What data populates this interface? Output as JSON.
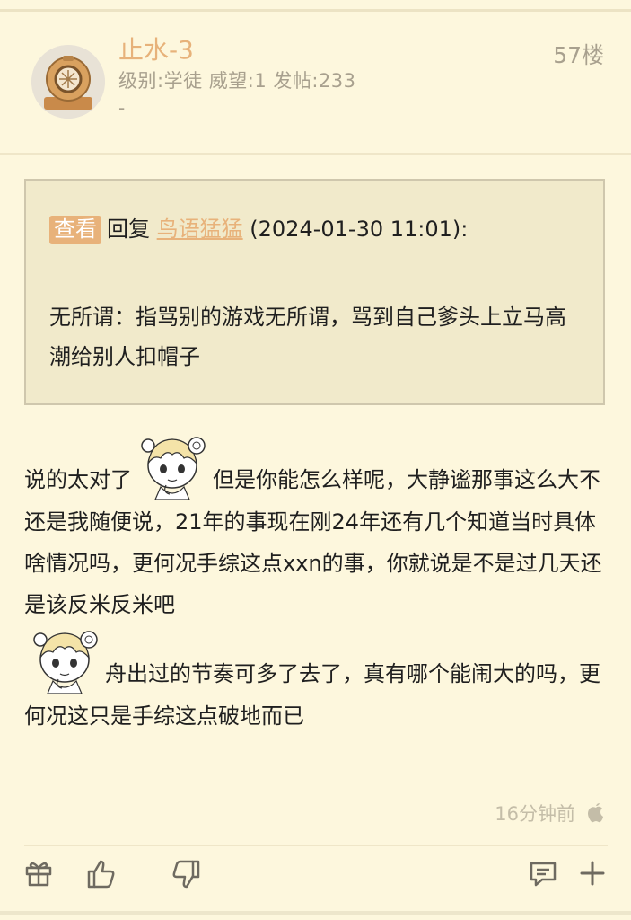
{
  "post": {
    "author": "止水-3",
    "meta": "级别:学徒 威望:1 发帖:233",
    "dash": "-",
    "floor": "57楼"
  },
  "quote": {
    "badge": "查看",
    "reply_prefix": "回复",
    "reply_user": "鸟语猛猛",
    "reply_time": "(2024-01-30 11:01):",
    "text": "无所谓：指骂别的游戏无所谓，骂到自己爹头上立马高潮给别人扣帽子"
  },
  "content": {
    "part1": "说的太对了",
    "part2": "但是你能怎么样呢，大静谧那事这么大不还是我随便说，21年的事现在刚24年还有几个知道当时具体啥情况吗，更何况手综这点xxn的事，你就说是不是过几天还是该反米反米吧",
    "part3": "舟出过的节奏可多了去了，真有哪个能闹大的吗，更何况这只是手综这点破地而已"
  },
  "footer": {
    "time": "16分钟前",
    "device_icon": "apple-icon"
  },
  "actions": [
    "gift-icon",
    "thumbs-up-icon",
    "thumbs-down-icon",
    "comment-icon",
    "plus-icon"
  ],
  "colors": {
    "background": "#fdf7dd",
    "accent": "#e8b27a",
    "muted": "#a8a08e",
    "quote_bg": "#f1eacb"
  }
}
